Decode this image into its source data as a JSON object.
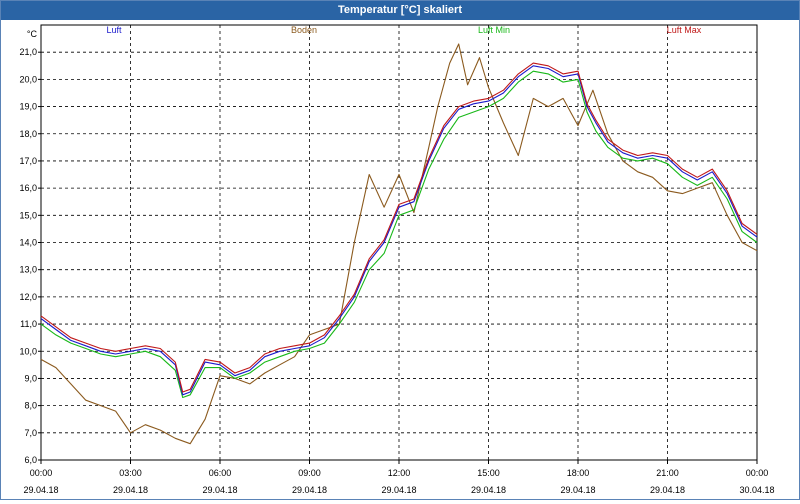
{
  "window": {
    "title": "Temperatur [°C] skaliert"
  },
  "chart_data": {
    "type": "line",
    "title": "Temperatur [°C] skaliert",
    "unit": "°C",
    "ylim": [
      6.0,
      22.0
    ],
    "yticks": [
      6.0,
      7.0,
      8.0,
      9.0,
      10.0,
      11.0,
      12.0,
      13.0,
      14.0,
      15.0,
      16.0,
      17.0,
      18.0,
      19.0,
      20.0,
      21.0
    ],
    "ytick_labels": [
      "6,0",
      "7,0",
      "8,0",
      "9,0",
      "10,0",
      "11,0",
      "12,0",
      "13,0",
      "14,0",
      "15,0",
      "16,0",
      "17,0",
      "18,0",
      "19,0",
      "20,0",
      "21,0"
    ],
    "xlim": [
      0,
      24
    ],
    "xticks": [
      0,
      3,
      6,
      9,
      12,
      15,
      18,
      21,
      24
    ],
    "xtick_time": [
      "00:00",
      "03:00",
      "06:00",
      "09:00",
      "12:00",
      "15:00",
      "18:00",
      "21:00",
      "00:00"
    ],
    "xtick_date": [
      "29.04.18",
      "29.04.18",
      "29.04.18",
      "29.04.18",
      "29.04.18",
      "29.04.18",
      "29.04.18",
      "29.04.18",
      "30.04.18"
    ],
    "grid": true,
    "legend_position": "top",
    "series": [
      {
        "name": "Luft",
        "color": "#1a1acc",
        "x": [
          0,
          0.5,
          1,
          1.5,
          2,
          2.5,
          3,
          3.5,
          4,
          4.5,
          4.75,
          5,
          5.5,
          6,
          6.5,
          7,
          7.5,
          8,
          8.5,
          9,
          9.5,
          10,
          10.5,
          11,
          11.5,
          12,
          12.5,
          13,
          13.5,
          14,
          14.5,
          15,
          15.5,
          16,
          16.5,
          17,
          17.5,
          18,
          18.3,
          18.6,
          19,
          19.5,
          20,
          20.5,
          21,
          21.5,
          22,
          22.5,
          23,
          23.5,
          24
        ],
        "y": [
          11.2,
          10.8,
          10.4,
          10.2,
          10.0,
          9.9,
          10.0,
          10.1,
          10.0,
          9.5,
          8.4,
          8.5,
          9.6,
          9.5,
          9.1,
          9.3,
          9.8,
          10.0,
          10.1,
          10.2,
          10.5,
          11.2,
          12.0,
          13.3,
          14.0,
          15.3,
          15.5,
          17.0,
          18.2,
          18.9,
          19.1,
          19.2,
          19.5,
          20.1,
          20.5,
          20.4,
          20.1,
          20.2,
          19.0,
          18.4,
          17.7,
          17.3,
          17.1,
          17.2,
          17.1,
          16.6,
          16.3,
          16.6,
          15.8,
          14.6,
          14.2
        ]
      },
      {
        "name": "Boden",
        "color": "#8b5a1e",
        "x": [
          0,
          0.5,
          1,
          1.5,
          2,
          2.5,
          3,
          3.5,
          4,
          4.5,
          5,
          5.5,
          6,
          6.5,
          7,
          7.5,
          8,
          8.5,
          9,
          9.5,
          10,
          10.5,
          11,
          11.5,
          12,
          12.5,
          13,
          13.3,
          13.7,
          14,
          14.3,
          14.7,
          15,
          15.5,
          16,
          16.5,
          17,
          17.5,
          18,
          18.5,
          19,
          19.5,
          20,
          20.5,
          21,
          21.5,
          22,
          22.5,
          23,
          23.5,
          24
        ],
        "y": [
          9.7,
          9.4,
          8.8,
          8.2,
          8.0,
          7.8,
          7.0,
          7.3,
          7.1,
          6.8,
          6.6,
          7.5,
          9.1,
          9.0,
          8.8,
          9.2,
          9.5,
          9.8,
          10.6,
          10.8,
          11.0,
          14.0,
          16.5,
          15.3,
          16.5,
          15.1,
          17.5,
          19.0,
          20.6,
          21.3,
          19.8,
          20.8,
          19.7,
          18.4,
          17.2,
          19.3,
          19.0,
          19.3,
          18.3,
          19.6,
          18.0,
          17.0,
          16.6,
          16.4,
          15.9,
          15.8,
          16.0,
          16.2,
          15.0,
          14.0,
          13.7
        ]
      },
      {
        "name": "Luft Min",
        "color": "#18b818",
        "x": [
          0,
          0.5,
          1,
          1.5,
          2,
          2.5,
          3,
          3.5,
          4,
          4.5,
          4.75,
          5,
          5.5,
          6,
          6.5,
          7,
          7.5,
          8,
          8.5,
          9,
          9.5,
          10,
          10.5,
          11,
          11.5,
          12,
          12.5,
          13,
          13.5,
          14,
          14.5,
          15,
          15.5,
          16,
          16.5,
          17,
          17.5,
          18,
          18.3,
          18.6,
          19,
          19.5,
          20,
          20.5,
          21,
          21.5,
          22,
          22.5,
          23,
          23.5,
          24
        ],
        "y": [
          11.0,
          10.6,
          10.3,
          10.1,
          9.9,
          9.8,
          9.9,
          10.0,
          9.8,
          9.3,
          8.3,
          8.4,
          9.4,
          9.4,
          9.0,
          9.2,
          9.6,
          9.8,
          10.0,
          10.1,
          10.3,
          11.0,
          11.8,
          13.0,
          13.6,
          15.0,
          15.2,
          16.7,
          17.8,
          18.6,
          18.8,
          19.0,
          19.3,
          19.9,
          20.3,
          20.2,
          19.9,
          20.0,
          18.8,
          18.1,
          17.5,
          17.1,
          17.0,
          17.1,
          16.9,
          16.4,
          16.1,
          16.4,
          15.6,
          14.4,
          14.0
        ]
      },
      {
        "name": "Luft Max",
        "color": "#c01818",
        "x": [
          0,
          0.5,
          1,
          1.5,
          2,
          2.5,
          3,
          3.5,
          4,
          4.5,
          4.75,
          5,
          5.5,
          6,
          6.5,
          7,
          7.5,
          8,
          8.5,
          9,
          9.5,
          10,
          10.5,
          11,
          11.5,
          12,
          12.5,
          13,
          13.5,
          14,
          14.5,
          15,
          15.5,
          16,
          16.5,
          17,
          17.5,
          18,
          18.3,
          18.6,
          19,
          19.5,
          20,
          20.5,
          21,
          21.5,
          22,
          22.5,
          23,
          23.5,
          24
        ],
        "y": [
          11.3,
          10.9,
          10.5,
          10.3,
          10.1,
          10.0,
          10.1,
          10.2,
          10.1,
          9.6,
          8.5,
          8.6,
          9.7,
          9.6,
          9.2,
          9.4,
          9.9,
          10.1,
          10.2,
          10.3,
          10.6,
          11.3,
          12.1,
          13.4,
          14.1,
          15.4,
          15.6,
          17.1,
          18.3,
          19.0,
          19.2,
          19.3,
          19.6,
          20.2,
          20.6,
          20.5,
          20.2,
          20.3,
          19.1,
          18.5,
          17.8,
          17.4,
          17.2,
          17.3,
          17.2,
          16.7,
          16.4,
          16.7,
          15.9,
          14.7,
          14.3
        ]
      }
    ]
  }
}
